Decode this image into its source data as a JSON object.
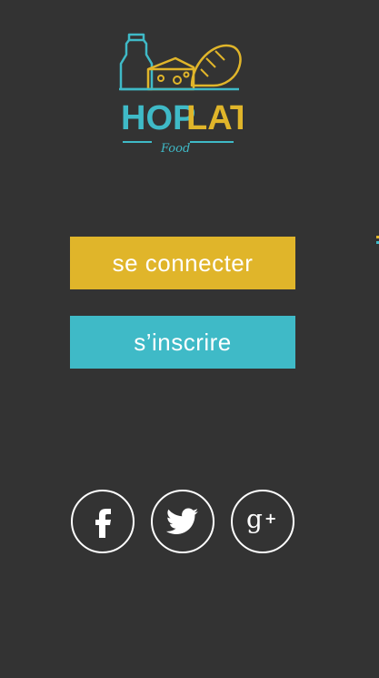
{
  "brand": {
    "name_part1": "HOP",
    "name_part2": "LAT",
    "tagline": "Food",
    "accent_yellow": "#e0b52a",
    "accent_teal": "#3fbac7",
    "logo_icon": "groceries-icon"
  },
  "actions": {
    "login_label": "se connecter",
    "signup_label": "s’inscrire",
    "login_color": "#e0b52a",
    "signup_color": "#3fbac7"
  },
  "social": [
    {
      "network": "facebook",
      "icon": "facebook-icon"
    },
    {
      "network": "twitter",
      "icon": "twitter-icon"
    },
    {
      "network": "google-plus",
      "icon": "google-plus-icon"
    }
  ],
  "theme": {
    "background": "#333333",
    "text": "#ffffff"
  }
}
